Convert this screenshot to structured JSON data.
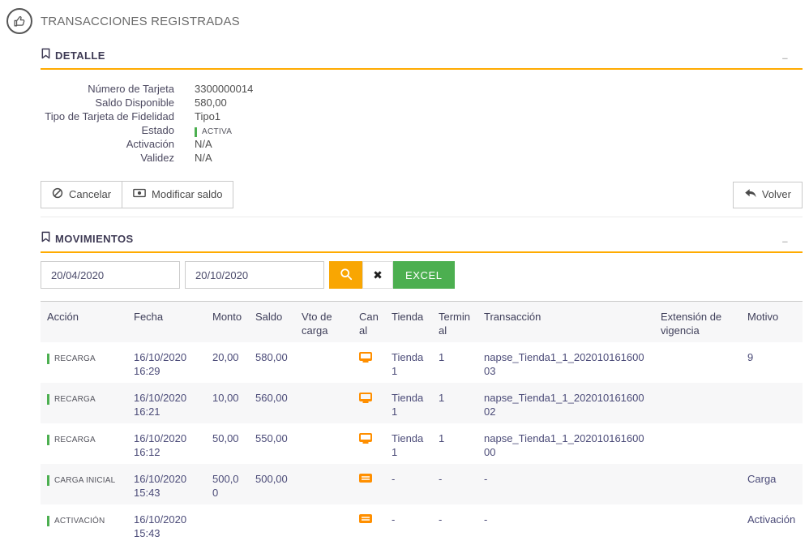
{
  "page": {
    "title": "TRANSACCIONES REGISTRADAS"
  },
  "colors": {
    "accent_amber": "#ffab00",
    "search_button": "#f9a602",
    "excel_green": "#4caf50",
    "status_green": "#4caf50",
    "channel_orange": "#ff8f00"
  },
  "detalle": {
    "title": "DETALLE",
    "collapse_label": "–",
    "fields": [
      {
        "label": "Número de Tarjeta",
        "value": "3300000014"
      },
      {
        "label": "Saldo Disponible",
        "value": "580,00"
      },
      {
        "label": "Tipo de Tarjeta de Fidelidad",
        "value": "Tipo1"
      },
      {
        "label": "Estado",
        "value": "ACTIVA"
      },
      {
        "label": "Activación",
        "value": "N/A"
      },
      {
        "label": "Validez",
        "value": "N/A"
      }
    ],
    "buttons": {
      "cancel": "Cancelar",
      "modify": "Modificar saldo",
      "back": "Volver"
    }
  },
  "movimientos": {
    "title": "MOVIMIENTOS",
    "collapse_label": "–",
    "filters": {
      "date_from": "20/04/2020",
      "date_to": "20/10/2020",
      "clear_label": "✖",
      "excel_label": "EXCEL"
    },
    "table": {
      "columns": [
        "Acción",
        "Fecha",
        "Monto",
        "Saldo",
        "Vto de carga",
        "Canal",
        "Tienda",
        "Terminal",
        "Transacción",
        "Extensión de vigencia",
        "Motivo"
      ],
      "rows": [
        {
          "accion": "RECARGA",
          "fecha": "16/10/2020 16:29",
          "monto": "20,00",
          "saldo": "580,00",
          "vto_de_carga": "",
          "canal_icon": "monitor",
          "tienda": "Tienda1",
          "terminal": "1",
          "transaccion": "napse_Tienda1_1_20201016160003",
          "extension": "",
          "motivo": "9"
        },
        {
          "accion": "RECARGA",
          "fecha": "16/10/2020 16:21",
          "monto": "10,00",
          "saldo": "560,00",
          "vto_de_carga": "",
          "canal_icon": "monitor",
          "tienda": "Tienda1",
          "terminal": "1",
          "transaccion": "napse_Tienda1_1_20201016160002",
          "extension": "",
          "motivo": ""
        },
        {
          "accion": "RECARGA",
          "fecha": "16/10/2020 16:12",
          "monto": "50,00",
          "saldo": "550,00",
          "vto_de_carga": "",
          "canal_icon": "monitor",
          "tienda": "Tienda1",
          "terminal": "1",
          "transaccion": "napse_Tienda1_1_20201016160000",
          "extension": "",
          "motivo": ""
        },
        {
          "accion": "CARGA INICIAL",
          "fecha": "16/10/2020 15:43",
          "monto": "500,00",
          "saldo": "500,00",
          "vto_de_carga": "",
          "canal_icon": "card",
          "tienda": "-",
          "terminal": "-",
          "transaccion": "-",
          "extension": "",
          "motivo": "Carga"
        },
        {
          "accion": "ACTIVACIÓN",
          "fecha": "16/10/2020 15:43",
          "monto": "",
          "saldo": "",
          "vto_de_carga": "",
          "canal_icon": "card",
          "tienda": "-",
          "terminal": "-",
          "transaccion": "-",
          "extension": "",
          "motivo": "Activación"
        }
      ]
    }
  }
}
